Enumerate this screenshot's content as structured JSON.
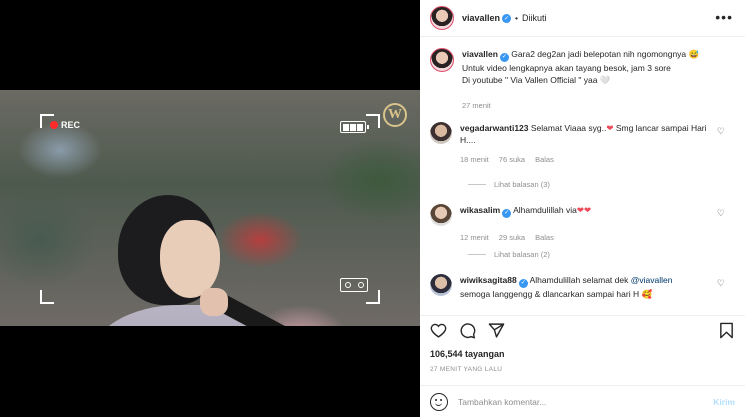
{
  "video": {
    "rec_label": "REC",
    "logo_letter": "W"
  },
  "header": {
    "username": "viavallen",
    "separator": "•",
    "follow_status": "Diikuti"
  },
  "caption": {
    "username": "viavallen",
    "line1": "Gara2 deg2an jadi belepotan nih ngomongnya 😅",
    "line2": "Untuk video lengkapnya akan tayang besok, jam 3 sore",
    "line3": "Di youtube \" Via Vallen Official \" yaa 🤍",
    "time": "27 menit"
  },
  "comments": [
    {
      "username": "vegadarwanti123",
      "text_before": "Selamat Viaaa syg..",
      "text_heart": "❤",
      "text_after": " Smg lancar sampai Hari H....",
      "time": "18 menit",
      "likes": "76 suka",
      "reply": "Balas",
      "view_replies": "Lihat balasan (3)"
    },
    {
      "username": "wikasalim",
      "text_before": "Alhamdulillah via",
      "text_heart": "❤❤",
      "text_after": "",
      "time": "12 menit",
      "likes": "29 suka",
      "reply": "Balas",
      "view_replies": "Lihat balasan (2)"
    },
    {
      "username": "wiwiksagita88",
      "text_before": "Alhamdulillah selamat dek ",
      "mention": "@viavallen",
      "text_after": "semoga langgengg & dlancarkan sampai hari H 🥰"
    }
  ],
  "stats": {
    "views": "106,544 tayangan",
    "posted_ago": "27 MENIT YANG LALU"
  },
  "comment_box": {
    "placeholder": "Tambahkan komentar...",
    "send_label": "Kirim"
  },
  "icons": {
    "more": "more-icon",
    "like": "heart-icon",
    "comment": "comment-icon",
    "share": "share-icon",
    "save": "bookmark-icon",
    "emoji": "emoji-icon"
  },
  "colors": {
    "verified": "#3897f0",
    "link": "#00376b",
    "heart": "#ed4956",
    "muted": "#8e8e8e",
    "send_disabled": "#b2dffc"
  }
}
